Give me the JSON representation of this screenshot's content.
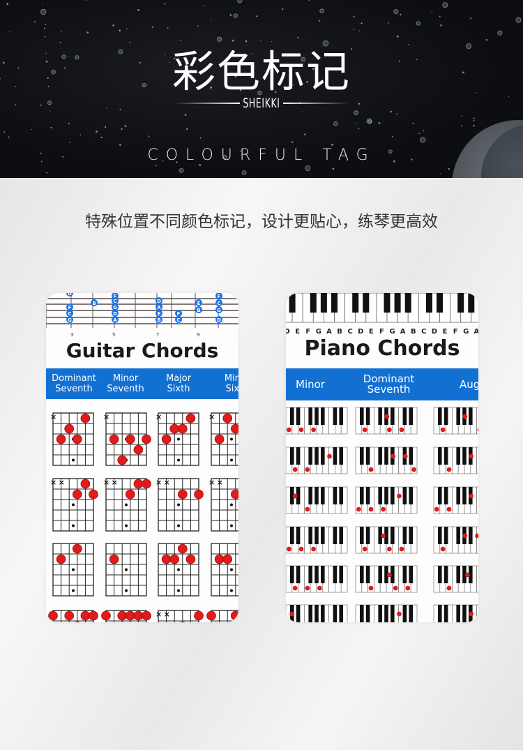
{
  "header": {
    "title_cn": "彩色标记",
    "brand": "SHEIKKI",
    "subtitle_en": "COLOURFUL TAG"
  },
  "tagline": "特殊位置不同颜色标记，设计更贴心，练琴更高效",
  "colors": {
    "accent_blue": "#1270d3",
    "marker_red": "#e01b1b",
    "note_blue": "#1a73e8",
    "banner_dark": "#0e0f13"
  },
  "guitar_card": {
    "title": "Guitar Chords",
    "fret_numbers": [
      "3",
      "5",
      "7",
      "9"
    ],
    "fretboard_notes": [
      [
        "D",
        "F",
        "C",
        "G"
      ],
      [
        "B"
      ],
      [
        "E",
        "C",
        "G",
        "D",
        "A"
      ],
      [
        "D",
        "A",
        "E",
        "B"
      ],
      [
        "F",
        "C"
      ],
      [
        "E",
        "B"
      ],
      [
        "F",
        "C",
        "G",
        "D"
      ]
    ],
    "columns": [
      {
        "label": "Dominant\nSeventh"
      },
      {
        "label": "Minor\nSeventh"
      },
      {
        "label": "Major\nSixth"
      },
      {
        "label": "Minor\nSixth"
      }
    ]
  },
  "piano_card": {
    "title": "Piano Chords",
    "key_letters": [
      "D",
      "E",
      "F",
      "G",
      "A",
      "B",
      "C",
      "D",
      "E",
      "F",
      "G",
      "A",
      "B",
      "C",
      "D",
      "E",
      "F",
      "G",
      "A"
    ],
    "columns": [
      {
        "label": "Minor"
      },
      {
        "label": "Dominant\nSeventh"
      },
      {
        "label": "Aug."
      }
    ]
  }
}
